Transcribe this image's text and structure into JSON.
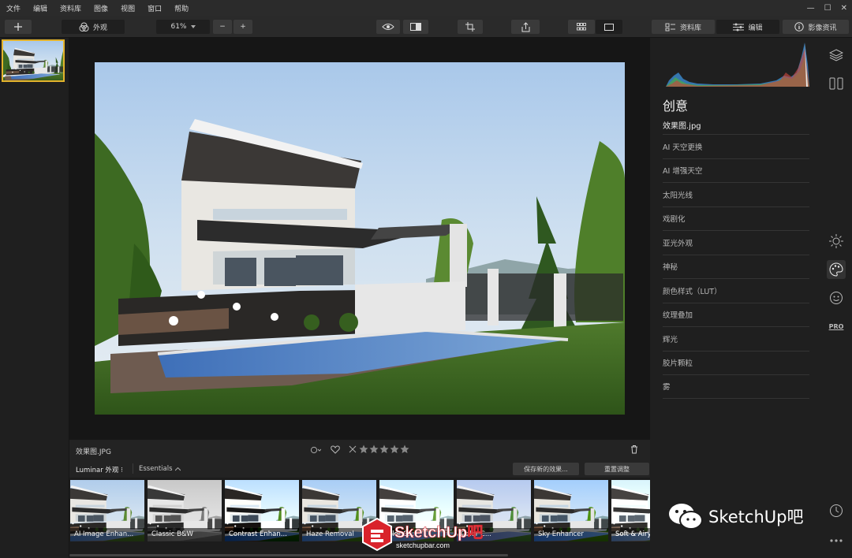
{
  "menu": [
    "文件",
    "编辑",
    "资料库",
    "图像",
    "视图",
    "窗口",
    "帮助"
  ],
  "window_controls": [
    "—",
    "☐",
    "✕"
  ],
  "toolbar": {
    "looks_label": "外观",
    "zoom_value": "61%",
    "zoom_minus": "−",
    "zoom_plus": "+",
    "tab_library": "资料库",
    "tab_edit": "编辑",
    "tab_info": "影像资讯"
  },
  "image": {
    "filename": "效果图.JPG"
  },
  "looks": {
    "collection_label": "Luminar 外观 ⁝",
    "category_label": "Essentials",
    "save_button": "保存新的效果...",
    "reset_button": "重置调整"
  },
  "presets": [
    {
      "label": "AI Image Enhan..."
    },
    {
      "label": "Classic B&W"
    },
    {
      "label": "Contrast Enhan..."
    },
    {
      "label": "Haze Removal"
    },
    {
      "label": "Color C..."
    },
    {
      "label": "Color C..."
    },
    {
      "label": "Sky Enhancer"
    },
    {
      "label": "Soft & Airy"
    }
  ],
  "panel": {
    "title": "创意",
    "file": "效果图.jpg",
    "tools": [
      "AI 天空更换",
      "AI 增强天空",
      "太阳光线",
      "戏剧化",
      "亚光外观",
      "神秘",
      "颜色样式（LUT）",
      "纹理叠加",
      "辉光",
      "胶片颗粒",
      "雾"
    ]
  },
  "rail_icons": [
    "layers-icon",
    "compare-icon",
    "sun-icon",
    "palette-icon",
    "face-icon",
    "pro-icon",
    "history-icon",
    "more-icon"
  ],
  "pro_badge": "PRO",
  "watermark": {
    "wechat_text": "SketchUp吧",
    "logo_text": "SketchUp吧",
    "logo_url_text": "sketchupbar.com"
  },
  "colors": {
    "accent": "#e3b32c",
    "panel_bg": "#1f1f1f",
    "canvas_bg": "#161616"
  }
}
